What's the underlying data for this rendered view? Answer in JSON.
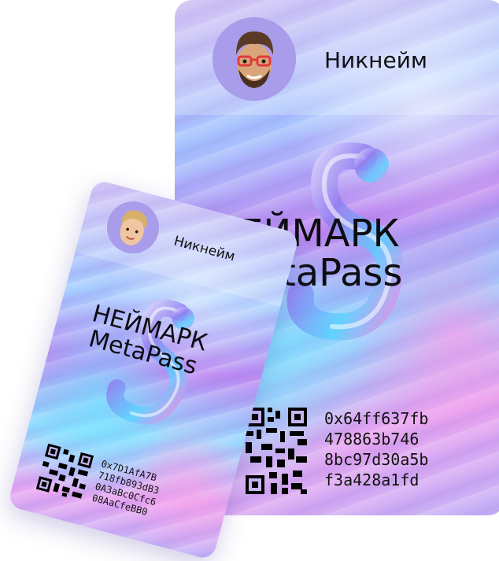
{
  "big_card": {
    "nickname": "Никнейм",
    "brand_line1": "НЕЙМАРК",
    "brand_line2": "MetaPass",
    "address_lines": [
      "0x64ff637fb",
      "478863b746",
      "8bc97d30a5b",
      "f3a428a1fd"
    ]
  },
  "small_card": {
    "nickname": "Никнейм",
    "brand_line1": "НЕЙМАРК",
    "brand_line2": "MetaPass",
    "address_lines": [
      "0x7D1AfA7B",
      "718fb893dB3",
      "0A3aBc0Cfc6",
      "08AaCfeBB0"
    ]
  },
  "icons": {
    "avatar_big": "memoji-bearded-glasses-icon",
    "avatar_small": "memoji-blond-icon",
    "logo": "glass-s-logo-icon",
    "qr": "qr-code-icon"
  }
}
